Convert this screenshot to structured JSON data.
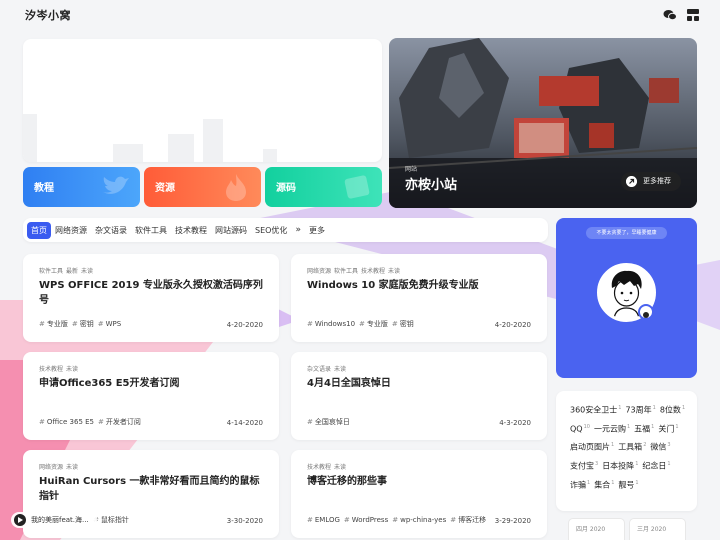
{
  "site": {
    "title": "汐岑小窝"
  },
  "hero": {
    "categories": [
      {
        "label": "教程",
        "color": "#3a8ef5"
      },
      {
        "label": "资源",
        "color": "#ff6a3d"
      },
      {
        "label": "源码",
        "color": "#1dd6a8"
      }
    ],
    "feature": {
      "small": "网站",
      "title": "亦桉小站",
      "more": "更多推荐"
    }
  },
  "nav": {
    "items": [
      "首页",
      "网络资源",
      "杂文语录",
      "软件工具",
      "技术教程",
      "网站源码",
      "SEO优化"
    ],
    "arrow": "»",
    "more": "更多"
  },
  "posts": [
    {
      "tags": [
        "软件工具",
        "最新",
        "未读"
      ],
      "title": "WPS OFFICE 2019 专业版永久授权激活码序列号",
      "keywords": [
        "专业版",
        "密钥",
        "WPS"
      ],
      "date": "4-20-2020"
    },
    {
      "tags": [
        "网络资源",
        "软件工具",
        "技术教程",
        "未读"
      ],
      "title": "Windows 10 家庭版免费升级专业版",
      "keywords": [
        "Windows10",
        "专业版",
        "密钥"
      ],
      "date": "4-20-2020"
    },
    {
      "tags": [
        "技术教程",
        "未读"
      ],
      "title": "申请Office365 E5开发者订阅",
      "keywords": [
        "Office 365 E5",
        "开发者订阅"
      ],
      "date": "4-14-2020"
    },
    {
      "tags": [
        "杂文语录",
        "未读"
      ],
      "title": "4月4日全国哀悼日",
      "keywords": [
        "全国哀悼日"
      ],
      "date": "4-3-2020"
    },
    {
      "tags": [
        "网络资源",
        "未读"
      ],
      "title": "HuiRan Cursors 一款非常好看而且简约的鼠标指针",
      "keywords": [
        "鼠标指针"
      ],
      "date": "3-30-2020"
    },
    {
      "tags": [
        "技术教程",
        "未读"
      ],
      "title": "博客迁移的那些事",
      "keywords": [
        "EMLOG",
        "WordPress",
        "wp-china-yes",
        "博客迁移"
      ],
      "date": "3-29-2020"
    }
  ],
  "profile": {
    "motto": "不要太贪要了，早睡要健康"
  },
  "tag_cloud": [
    {
      "name": "360安全卫士",
      "count": "1"
    },
    {
      "name": "73周年",
      "count": "1"
    },
    {
      "name": "8位数",
      "count": "1"
    },
    {
      "name": "QQ",
      "count": "10"
    },
    {
      "name": "一元云购",
      "count": "1"
    },
    {
      "name": "五福",
      "count": "1"
    },
    {
      "name": "关门",
      "count": "1"
    },
    {
      "name": "启动页图片",
      "count": "1"
    },
    {
      "name": "工具箱",
      "count": "2"
    },
    {
      "name": "微信",
      "count": "3"
    },
    {
      "name": "支付宝",
      "count": "3"
    },
    {
      "name": "日本投降",
      "count": "1"
    },
    {
      "name": "纪念日",
      "count": "1"
    },
    {
      "name": "诈骗",
      "count": "1"
    },
    {
      "name": "集合",
      "count": "1"
    },
    {
      "name": "靓号",
      "count": "1"
    }
  ],
  "archive": [
    {
      "label": "四月 2020"
    },
    {
      "label": "三月 2020"
    }
  ],
  "player": {
    "text": "我的美丽feat.海..."
  }
}
